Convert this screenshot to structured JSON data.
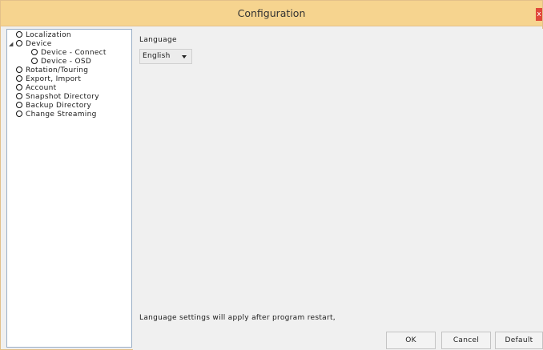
{
  "window": {
    "title": "Configuration",
    "close_label": "x"
  },
  "nav": {
    "items": [
      {
        "label": "Localization"
      },
      {
        "label": "Device"
      },
      {
        "label": "Device - Connect"
      },
      {
        "label": "Device - OSD"
      },
      {
        "label": "Rotation/Touring"
      },
      {
        "label": "Export, Import"
      },
      {
        "label": "Account"
      },
      {
        "label": "Snapshot Directory"
      },
      {
        "label": "Backup Directory"
      },
      {
        "label": "Change Streaming"
      }
    ]
  },
  "main": {
    "language_label": "Language",
    "language_value": "English",
    "restart_note": "Language settings will apply after program restart,"
  },
  "buttons": {
    "ok": "OK",
    "cancel": "Cancel",
    "default": "Default"
  },
  "colors": {
    "titlebar": "#f6d48f",
    "close": "#e0483a",
    "panel": "#f0f0f0"
  }
}
